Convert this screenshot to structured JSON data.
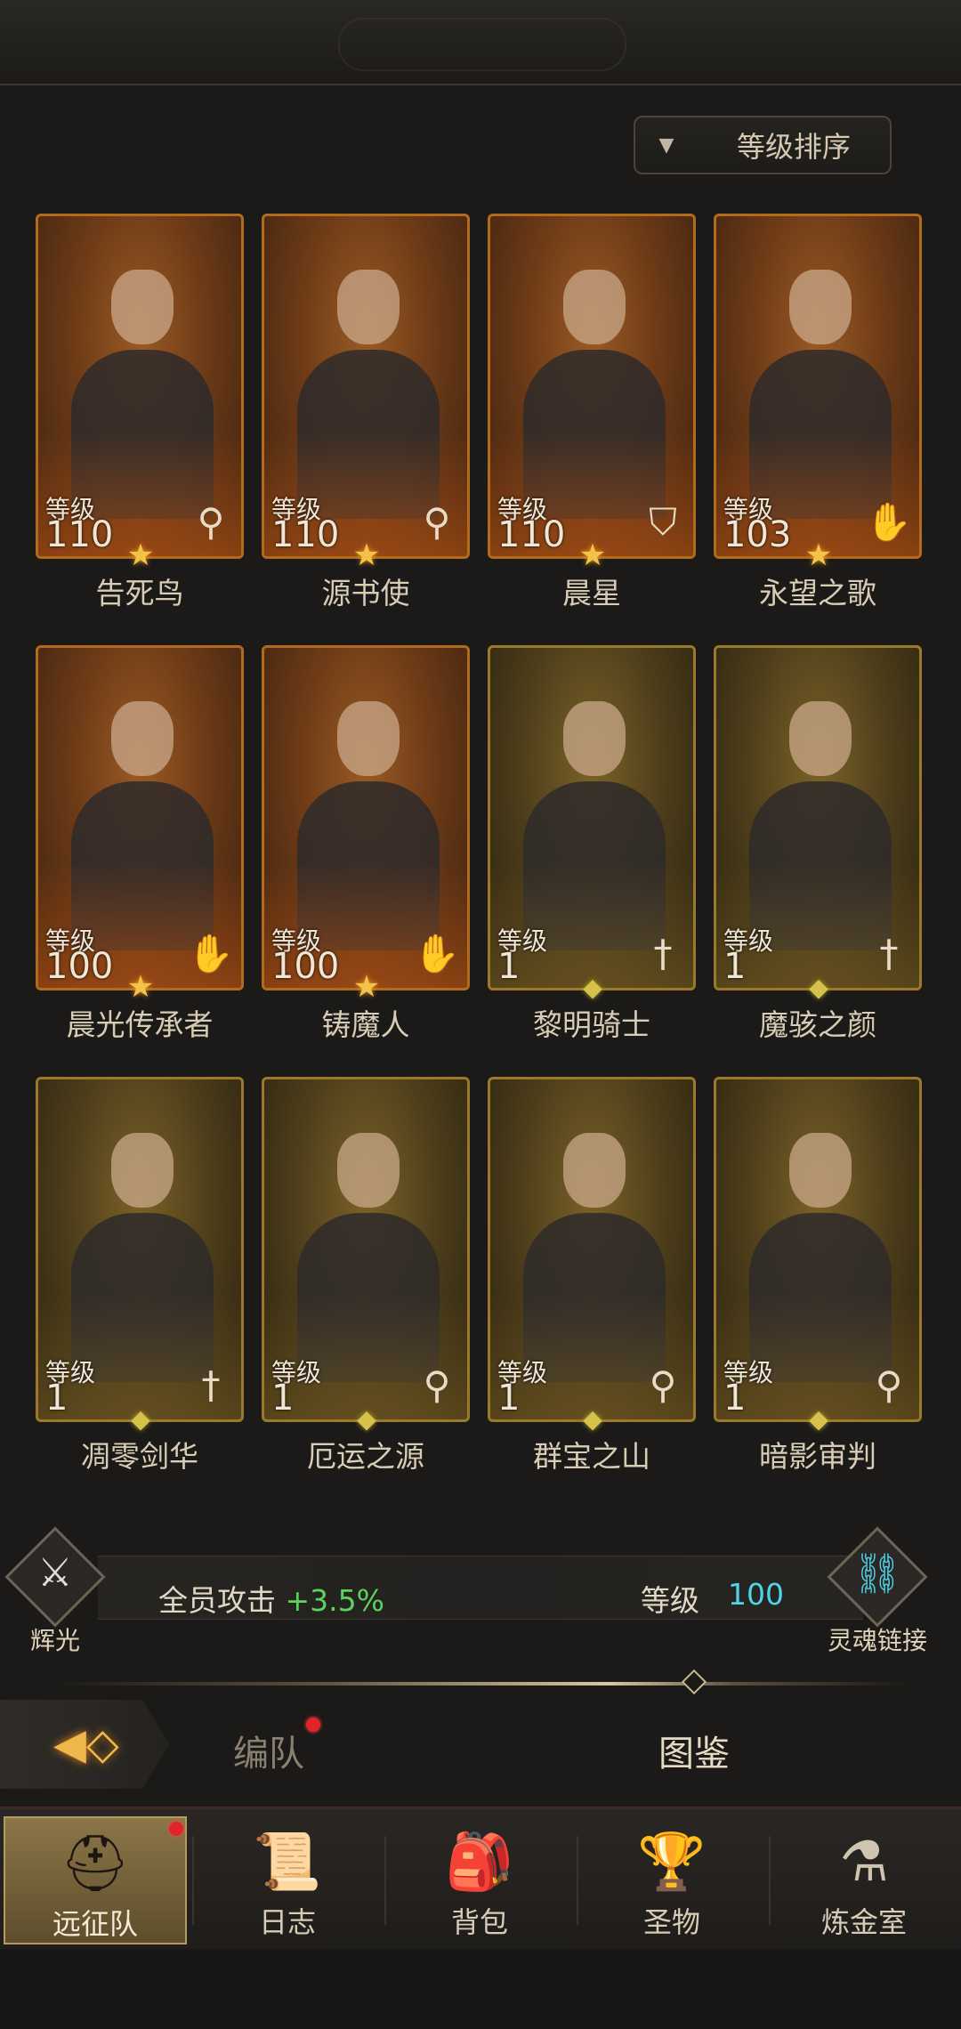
{
  "sort": {
    "label": "等级排序",
    "caret": "▼"
  },
  "level_label": "等级",
  "heroes": [
    {
      "name": "告死鸟",
      "level": "110",
      "class_icon": "staff-icon",
      "tier": "orange",
      "rank": "star"
    },
    {
      "name": "源书使",
      "level": "110",
      "class_icon": "staff-icon",
      "tier": "orange",
      "rank": "star"
    },
    {
      "name": "晨星",
      "level": "110",
      "class_icon": "shield-icon",
      "tier": "orange",
      "rank": "star"
    },
    {
      "name": "永望之歌",
      "level": "103",
      "class_icon": "hand-icon",
      "tier": "orange",
      "rank": "star"
    },
    {
      "name": "晨光传承者",
      "level": "100",
      "class_icon": "hand-icon",
      "tier": "orange",
      "rank": "star"
    },
    {
      "name": "铸魔人",
      "level": "100",
      "class_icon": "hand-icon",
      "tier": "orange",
      "rank": "star"
    },
    {
      "name": "黎明骑士",
      "level": "1",
      "class_icon": "sword-icon",
      "tier": "gold",
      "rank": "diamond"
    },
    {
      "name": "魔骇之颜",
      "level": "1",
      "class_icon": "sword-icon",
      "tier": "gold",
      "rank": "diamond"
    },
    {
      "name": "凋零剑华",
      "level": "1",
      "class_icon": "sword-icon",
      "tier": "gold",
      "rank": "diamond"
    },
    {
      "name": "厄运之源",
      "level": "1",
      "class_icon": "staff-icon",
      "tier": "gold",
      "rank": "diamond"
    },
    {
      "name": "群宝之山",
      "level": "1",
      "class_icon": "staff-icon",
      "tier": "gold",
      "rank": "diamond"
    },
    {
      "name": "暗影审判",
      "level": "1",
      "class_icon": "staff-icon",
      "tier": "gold",
      "rank": "diamond"
    }
  ],
  "bonus": {
    "left_emblem_label": "辉光",
    "team_attack_label": "全员攻击",
    "team_attack_value": "+3.5%",
    "soul_level_label": "等级",
    "soul_level_value": "100",
    "right_emblem_label": "灵魂链接"
  },
  "subtabs": [
    {
      "label": "编队",
      "has_badge": true
    },
    {
      "label": "图鉴",
      "active": true
    }
  ],
  "nav": [
    {
      "label": "远征队",
      "icon": "helmet-icon",
      "active": true,
      "has_badge": true
    },
    {
      "label": "日志",
      "icon": "scroll-icon"
    },
    {
      "label": "背包",
      "icon": "bag-icon"
    },
    {
      "label": "圣物",
      "icon": "chalice-icon"
    },
    {
      "label": "炼金室",
      "icon": "alchemy-icon"
    }
  ],
  "colors": {
    "orange_frame": "#b26a1c",
    "gold_frame": "#9a7a2a",
    "bonus_green": "#5ad45a",
    "soul_cyan": "#4fd4e8",
    "badge_red": "#e0242a"
  }
}
